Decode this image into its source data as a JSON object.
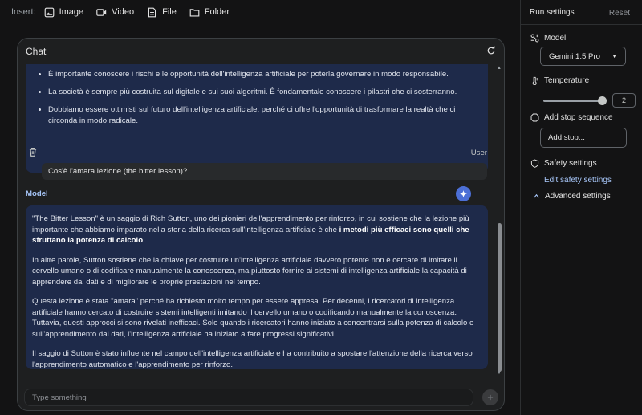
{
  "insert_bar": {
    "label": "Insert:",
    "items": [
      {
        "label": "Image",
        "icon": "image-icon"
      },
      {
        "label": "Video",
        "icon": "video-icon"
      },
      {
        "label": "File",
        "icon": "file-icon"
      },
      {
        "label": "Folder",
        "icon": "folder-icon"
      }
    ]
  },
  "chat": {
    "title": "Chat",
    "previous_bullets": [
      "È importante conoscere i rischi e le opportunità dell'intelligenza artificiale per poterla governare in modo responsabile.",
      "La società è sempre più costruita sul digitale e sui suoi algoritmi. È fondamentale conoscere i pilastri che ci sosterranno.",
      "Dobbiamo essere ottimisti sul futuro dell'intelligenza artificiale, perché ci offre l'opportunità di trasformare la realtà che ci circonda in modo radicale."
    ],
    "user_label": "User",
    "user_message": "Cos'è l'amara lezione (the bitter lesson)?",
    "model_label": "Model",
    "model_p1_a": "\"The Bitter Lesson\" è un saggio di Rich Sutton, uno dei pionieri dell'apprendimento per rinforzo, in cui sostiene che la lezione più importante che abbiamo imparato nella storia della ricerca sull'intelligenza artificiale è che ",
    "model_p1_bold": "i metodi più efficaci sono quelli che sfruttano la potenza di calcolo",
    "model_p1_end": ".",
    "model_p2": "In altre parole, Sutton sostiene che la chiave per costruire un'intelligenza artificiale davvero potente non è cercare di imitare il cervello umano o di codificare manualmente la conoscenza, ma piuttosto fornire ai sistemi di intelligenza artificiale la capacità di apprendere dai dati e di migliorare le proprie prestazioni nel tempo.",
    "model_p3": "Questa lezione è stata \"amara\" perché ha richiesto molto tempo per essere appresa. Per decenni, i ricercatori di intelligenza artificiale hanno cercato di costruire sistemi intelligenti imitando il cervello umano o codificando manualmente la conoscenza. Tuttavia, questi approcci si sono rivelati inefficaci. Solo quando i ricercatori hanno iniziato a concentrarsi sulla potenza di calcolo e sull'apprendimento dai dati, l'intelligenza artificiale ha iniziato a fare progressi significativi.",
    "model_p4": "Il saggio di Sutton è stato influente nel campo dell'intelligenza artificiale e ha contribuito a spostare l'attenzione della ricerca verso l'apprendimento automatico e l'apprendimento per rinforzo.",
    "input_placeholder": "Type something"
  },
  "run_settings": {
    "title": "Run settings",
    "reset": "Reset",
    "model_label": "Model",
    "model_value": "Gemini 1.5 Pro",
    "temperature_label": "Temperature",
    "temperature_value": "2",
    "temperature_level": 1.0,
    "stop_label": "Add stop sequence",
    "stop_placeholder": "Add stop...",
    "safety_label": "Safety settings",
    "edit_safety": "Edit safety settings",
    "advanced_label": "Advanced settings"
  }
}
